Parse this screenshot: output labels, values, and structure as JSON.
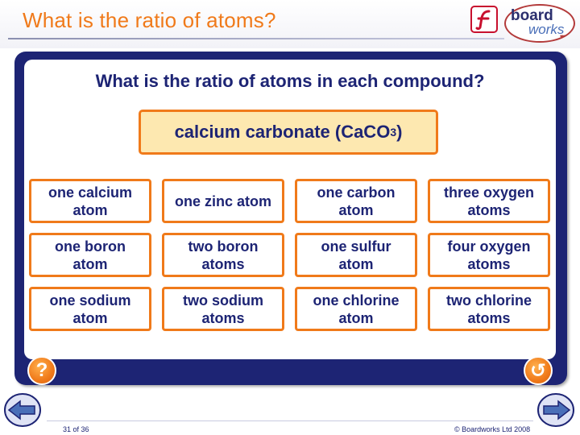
{
  "header": {
    "title": "What is the ratio of atoms?",
    "logo_text_top": "board",
    "logo_text_bottom": "works",
    "logo_dots": "•••"
  },
  "activity": {
    "question": "What is the ratio of atoms in each compound?",
    "compound_name": "calcium carbonate (CaCO",
    "compound_subscript": "3",
    "compound_close": ")",
    "options": [
      "one calcium\natom",
      "one zinc atom",
      "one carbon\natom",
      "three oxygen\natoms",
      "one boron\natom",
      "two boron\natoms",
      "one sulfur\natom",
      "four oxygen\natoms",
      "one sodium\natom",
      "two sodium\natoms",
      "one chlorine\natom",
      "two chlorine\natoms"
    ],
    "help_label": "?",
    "back_label": "↺"
  },
  "footer": {
    "slide_counter": "31 of 36",
    "copyright": "© Boardworks Ltd 2008"
  },
  "colors": {
    "accent_orange": "#f07a1a",
    "navy": "#1d2474",
    "compound_fill": "#fde8b0"
  }
}
